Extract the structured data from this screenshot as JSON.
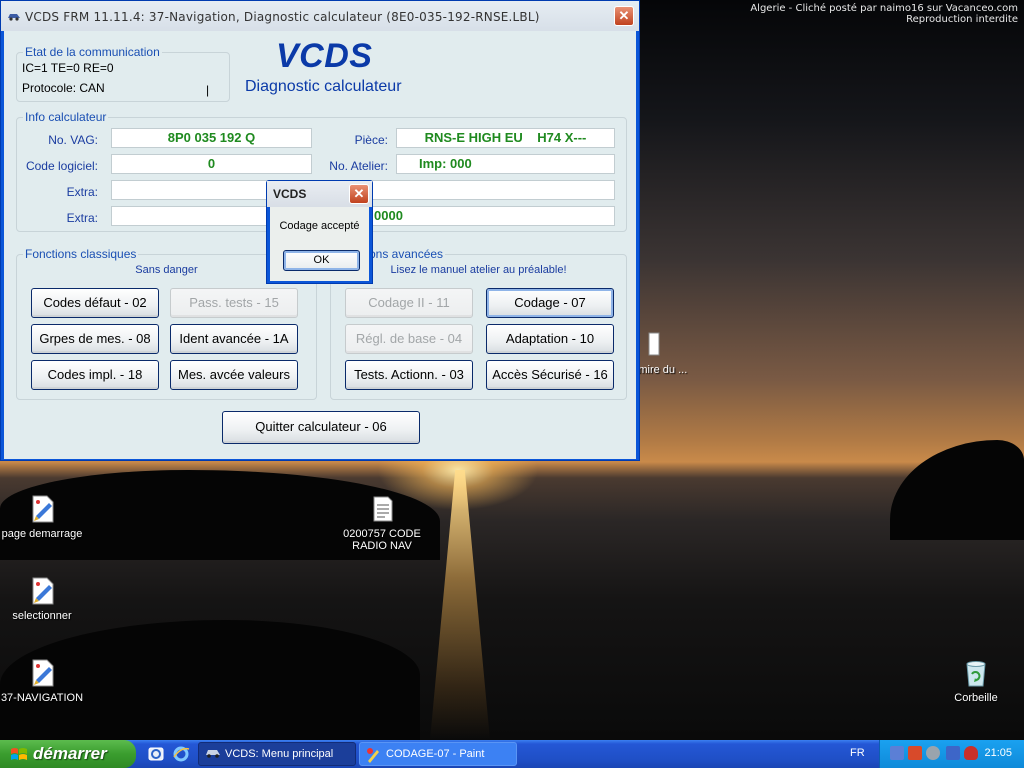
{
  "watermark": {
    "line1": "Algerie - Cliché posté par naimo16 sur Vacanceo.com",
    "line2": "Reproduction interdite"
  },
  "desktop": {
    "icons": [
      {
        "label": "page demarrage",
        "icon": "paint-document-icon"
      },
      {
        "label": "selectionner",
        "icon": "paint-document-icon"
      },
      {
        "label": "37-NAVIGATION",
        "icon": "paint-document-icon"
      },
      {
        "label": "0200757 CODE RADIO NAV",
        "icon": "text-document-icon"
      },
      {
        "label": "la mire du ...",
        "icon": "document-icon"
      },
      {
        "label": "Corbeille",
        "icon": "recycle-bin-icon"
      }
    ]
  },
  "vcds_window": {
    "title": "VCDS FRM 11.11.4: 37-Navigation,  Diagnostic calculateur (8E0-035-192-RNSE.LBL)",
    "brand": "VCDS",
    "subtitle": "Diagnostic calculateur",
    "comm": {
      "legend": "Etat de la communication",
      "status": "IC=1  TE=0   RE=0",
      "protocol": "Protocole: CAN",
      "indicator": "|"
    },
    "info": {
      "legend": "Info calculateur",
      "vag_label": "No. VAG:",
      "vag_value": "8P0 035 192 Q",
      "piece_label": "Pièce:",
      "piece_value": "RNS-E HIGH EU    H74 X---",
      "software_label": "Code logiciel:",
      "software_value": "0",
      "atelier_label": "No. Atelier:",
      "atelier_value": "Imp: 000",
      "extra1_label": "Extra:",
      "extra1_value": "",
      "extra1_right": "",
      "extra2_label": "Extra:",
      "extra2_value": "",
      "extra2_right": "0000"
    },
    "basic": {
      "legend": "Fonctions classiques",
      "note": "Sans danger",
      "buttons": {
        "codes_defaut": "Codes défaut - 02",
        "pass_tests": "Pass. tests - 15",
        "grpes_mes": "Grpes de mes. - 08",
        "ident_avancee": "Ident avancée - 1A",
        "codes_impl": "Codes impl. - 18",
        "mes_avcee": "Mes. avcée valeurs"
      }
    },
    "advanced": {
      "legend": "ons avancées",
      "note": "Lisez le manuel atelier au préalable!",
      "buttons": {
        "codage_ii": "Codage II - 11",
        "codage": "Codage - 07",
        "regl_base": "Régl. de base - 04",
        "adaptation": "Adaptation - 10",
        "tests_actionn": "Tests. Actionn. - 03",
        "acces_securise": "Accès Sécurisé - 16"
      }
    },
    "quit": "Quitter calculateur - 06",
    "close": "✕"
  },
  "dialog": {
    "title": "VCDS",
    "message": "Codage accepté",
    "ok": "OK",
    "close": "✕"
  },
  "taskbar": {
    "start": "démarrer",
    "tasks": [
      {
        "label": "VCDS:  Menu principal",
        "active": true
      },
      {
        "label": "CODAGE-07 - Paint",
        "active": false
      }
    ],
    "language": "FR",
    "clock": "21:05"
  },
  "colors": {
    "window_frame": "#0b56d8",
    "window_client": "#e1ecee",
    "brand_blue": "#0b3aa8",
    "value_green": "#1f8a1f",
    "start_green": "#3a9d2e"
  }
}
